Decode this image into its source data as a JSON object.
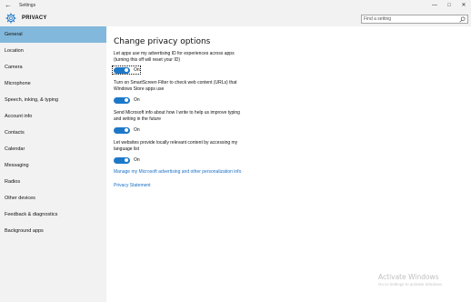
{
  "window": {
    "title": "Settings",
    "back_glyph": "←",
    "controls": {
      "minimize": "—",
      "maximize": "□",
      "close": "✕"
    }
  },
  "header": {
    "icon": "gear-icon",
    "title": "PRIVACY",
    "search": {
      "placeholder": "Find a setting",
      "value": "",
      "icon": "search-icon"
    }
  },
  "sidebar": {
    "items": [
      {
        "label": "General",
        "selected": true
      },
      {
        "label": "Location"
      },
      {
        "label": "Camera"
      },
      {
        "label": "Microphone"
      },
      {
        "label": "Speech, inking, & typing"
      },
      {
        "label": "Account info"
      },
      {
        "label": "Contacts"
      },
      {
        "label": "Calendar"
      },
      {
        "label": "Messaging"
      },
      {
        "label": "Radios"
      },
      {
        "label": "Other devices"
      },
      {
        "label": "Feedback & diagnostics"
      },
      {
        "label": "Background apps"
      }
    ]
  },
  "main": {
    "heading": "Change privacy options",
    "settings": [
      {
        "desc_line1": "Let apps use my advertising ID for experiences across apps",
        "desc_line2": "(turning this off will reset your ID)",
        "state": "On"
      },
      {
        "desc_line1": "Turn on SmartScreen Filter to check web content (URLs) that",
        "desc_line2": "Windows Store apps use",
        "state": "On"
      },
      {
        "desc_line1": "Send Microsoft info about how I write to help us improve typing",
        "desc_line2": "and writing in the future",
        "state": "On"
      },
      {
        "desc_line1": "Let websites provide locally relevant content by accessing my",
        "desc_line2": "language list",
        "state": "On"
      }
    ],
    "links": {
      "manage": "Manage my Microsoft advertising and other personalization info",
      "privacy": "Privacy Statement"
    }
  },
  "watermark": {
    "title": "Activate Windows",
    "subtitle": "Go to Settings to activate Windows."
  },
  "colors": {
    "accent": "#1e78c8",
    "selected_nav": "#82b8db",
    "link": "#1a6fc4",
    "chrome_bg": "#f2f2f2"
  }
}
